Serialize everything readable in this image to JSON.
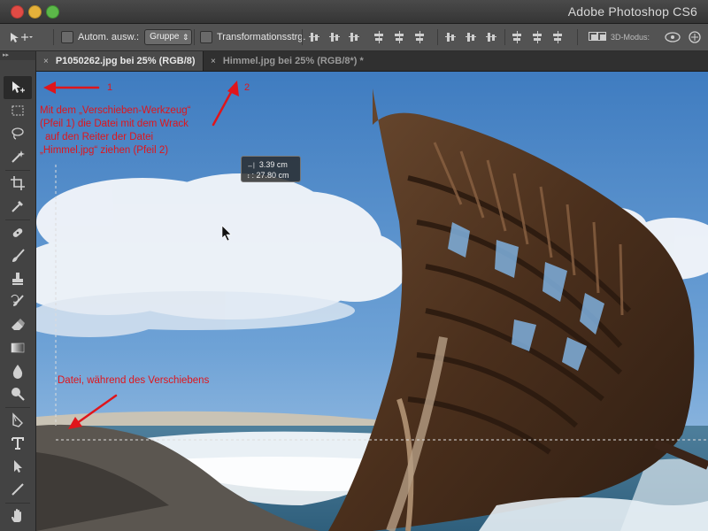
{
  "window": {
    "title": "Adobe Photoshop CS6"
  },
  "options_bar": {
    "auto_select_label": "Autom. ausw.:",
    "auto_select_value": "Gruppe",
    "transform_label": "Transformationsstrg.",
    "mode_3d_label": "3D-Modus:"
  },
  "tabs": [
    {
      "label": "P1050262.jpg bei 25% (RGB/8)",
      "close": "×",
      "active": true
    },
    {
      "label": "Himmel.jpg bei 25% (RGB/8*) *",
      "close": "×",
      "active": false
    }
  ],
  "panel_handle": "▸▸",
  "tooltip": {
    "x_line": "3.39 cm",
    "y_line": ": 27.80 cm"
  },
  "annotations": {
    "number_1": "1",
    "number_2": "2",
    "instruction": [
      "Mit dem „Verschieben-Werkzeug“",
      "(Pfeil 1) die Datei mit dem Wrack",
      "auf den Reiter der Datei",
      "„Himmel.jpg“  ziehen (Pfeil 2)"
    ],
    "during_move": "Datei, während des Verschiebens"
  },
  "colors": {
    "annotation_red": "#e0151b",
    "sky": "#4d86c2",
    "wreck": "#5a3a24"
  },
  "tools": [
    "move-tool-icon",
    "marquee-tool-icon",
    "lasso-tool-icon",
    "magic-wand-tool-icon",
    "crop-tool-icon",
    "eyedropper-tool-icon",
    "healing-brush-tool-icon",
    "brush-tool-icon",
    "clone-stamp-tool-icon",
    "history-brush-tool-icon",
    "eraser-tool-icon",
    "gradient-tool-icon",
    "blur-tool-icon",
    "dodge-tool-icon",
    "pen-tool-icon",
    "type-tool-icon",
    "path-selection-tool-icon",
    "line-tool-icon",
    "hand-tool-icon"
  ]
}
